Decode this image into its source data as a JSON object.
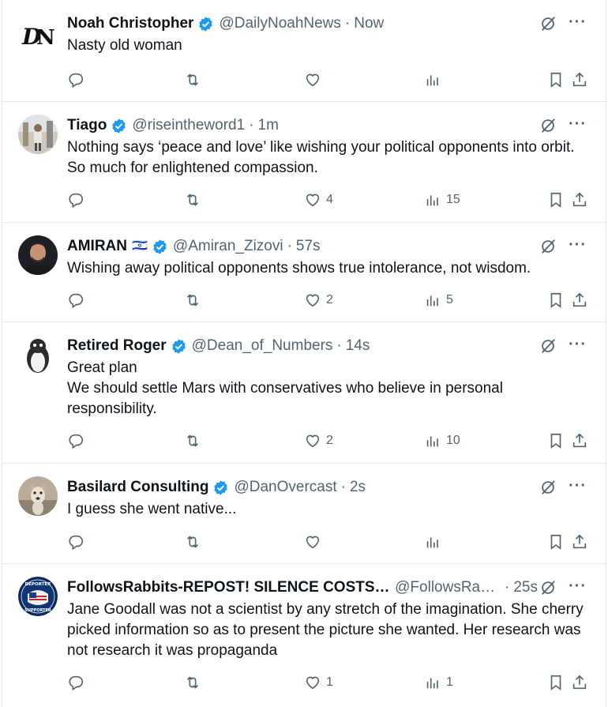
{
  "tweets": [
    {
      "name": "Noah Christopher",
      "flag": "",
      "handle": "@DailyNoahNews",
      "time": "Now",
      "text": "Nasty old woman",
      "likes": "",
      "views": "",
      "avatar": "dn-logo"
    },
    {
      "name": "Tiago",
      "flag": "",
      "handle": "@riseintheword1",
      "time": "1m",
      "text": "Nothing says ‘peace and love’ like wishing your political opponents into orbit. So much for enlightened compassion.",
      "likes": "4",
      "views": "15",
      "avatar": "photo-person"
    },
    {
      "name": "AMIRAN",
      "flag": "🇮🇱",
      "handle": "@Amiran_Zizovi",
      "time": "57s",
      "text": "Wishing away political opponents shows true intolerance, not wisdom.",
      "likes": "2",
      "views": "5",
      "avatar": "photo-man"
    },
    {
      "name": "Retired Roger",
      "flag": "",
      "handle": "@Dean_of_Numbers",
      "time": "14s",
      "text": "Great plan\nWe should settle Mars with conservatives who believe in personal responsibility.",
      "likes": "2",
      "views": "10",
      "avatar": "penguin"
    },
    {
      "name": "Basilard Consulting",
      "flag": "",
      "handle": "@DanOvercast",
      "time": "2s",
      "text": "I guess she went native...",
      "likes": "",
      "views": "",
      "avatar": "dog"
    },
    {
      "name": "FollowsRabbits-REPOST! SILENCE COSTS ...",
      "flag": "",
      "handle": "@FollowsRab...",
      "time": "25s",
      "text": "Jane Goodall was not a scientist by any stretch of the imagination. She cherry picked information so as to present the picture she wanted. Her research was not research it was propaganda",
      "likes": "1",
      "views": "1",
      "avatar": "deporter-badge"
    }
  ],
  "colors": {
    "verified": "#1d9bf0",
    "secondary_text": "#536471",
    "divider": "#e6e9ec"
  }
}
